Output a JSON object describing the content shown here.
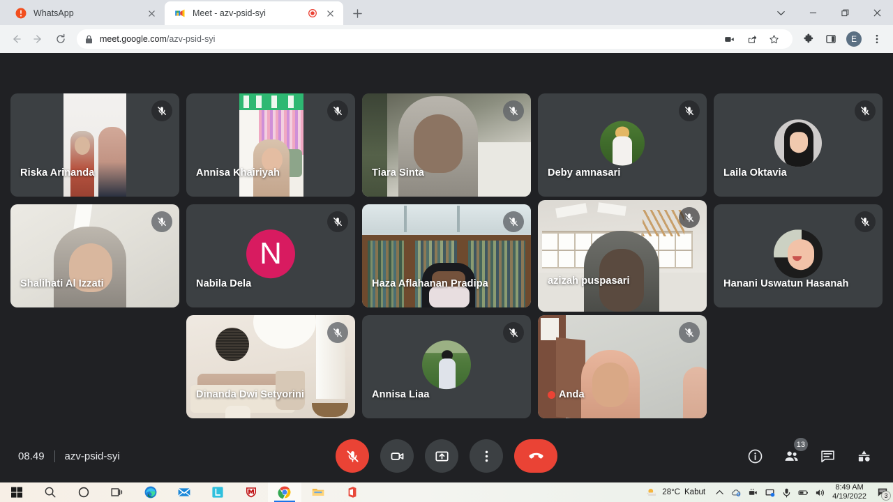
{
  "browser": {
    "tabs": [
      {
        "title": "WhatsApp",
        "favicon": "whatsapp-icon",
        "active": false,
        "recording": false
      },
      {
        "title": "Meet - azv-psid-syi",
        "favicon": "google-meet-icon",
        "active": true,
        "recording": true
      }
    ],
    "new_tab_label": "+",
    "window_controls": [
      "chevron-down",
      "minimize",
      "restore",
      "close"
    ],
    "address": {
      "host": "meet.google.com",
      "path": "/azv-psid-syi",
      "secure": true
    },
    "toolbar_icons": [
      "video-call-icon",
      "share-icon",
      "bookmark-star-icon",
      "extensions-icon",
      "side-panel-icon"
    ],
    "profile_initial": "E"
  },
  "meet": {
    "participants": [
      {
        "name": "Riska Arinanda",
        "muted": true,
        "kind": "video",
        "mic_badge": "dark"
      },
      {
        "name": "Annisa Khairiyah",
        "muted": true,
        "kind": "video",
        "mic_badge": "dark"
      },
      {
        "name": "Tiara Sinta",
        "muted": true,
        "kind": "video",
        "mic_badge": "light"
      },
      {
        "name": "Deby amnasari",
        "muted": true,
        "kind": "avatar",
        "mic_badge": "dark"
      },
      {
        "name": "Laila Oktavia",
        "muted": true,
        "kind": "avatar",
        "mic_badge": "dark"
      },
      {
        "name": "Shalihati Al Izzati",
        "muted": true,
        "kind": "video",
        "mic_badge": "light"
      },
      {
        "name": "Nabila Dela",
        "muted": true,
        "kind": "letter",
        "letter": "N",
        "letter_color": "#d81b60",
        "mic_badge": "dark"
      },
      {
        "name": "Haza Aflahanan Pradipa",
        "muted": true,
        "kind": "video",
        "mic_badge": "light"
      },
      {
        "name": "azizah puspasari",
        "muted": true,
        "kind": "video",
        "mic_badge": "dark"
      },
      {
        "name": "Hanani Uswatun Hasanah",
        "muted": true,
        "kind": "avatar",
        "mic_badge": "dark"
      },
      {
        "name": "Dinanda Dwi Setyorini",
        "muted": true,
        "kind": "video",
        "mic_badge": "light"
      },
      {
        "name": "Annisa Liaa",
        "muted": true,
        "kind": "avatar",
        "mic_badge": "dark"
      },
      {
        "name": "Anda",
        "muted": true,
        "kind": "video",
        "mic_badge": "light",
        "self": true
      }
    ],
    "bottom_bar": {
      "time": "08.49",
      "meeting_code": "azv-psid-syi",
      "controls": [
        {
          "name": "microphone-off-button",
          "state": "muted"
        },
        {
          "name": "camera-button",
          "state": "on"
        },
        {
          "name": "present-screen-button",
          "state": "off"
        },
        {
          "name": "more-options-button",
          "state": "off"
        },
        {
          "name": "leave-call-button",
          "state": "danger"
        }
      ],
      "right_controls": [
        {
          "name": "meeting-details-button"
        },
        {
          "name": "show-everyone-button",
          "badge": "13"
        },
        {
          "name": "chat-button"
        },
        {
          "name": "activities-button"
        }
      ]
    }
  },
  "taskbar": {
    "items": [
      "start-button",
      "search-icon",
      "cortana-icon",
      "task-view-icon",
      "microsoft-edge-icon",
      "mail-icon",
      "line-icon",
      "mcafee-icon",
      "google-chrome-icon",
      "file-explorer-icon",
      "office-icon"
    ],
    "tray": {
      "weather_temp": "28°C",
      "weather_desc": "Kabut",
      "icons": [
        "show-hidden-icons-chevron",
        "onedrive-icon",
        "camera-privacy-icon",
        "screen-share-icon",
        "microphone-icon",
        "battery-icon",
        "volume-icon"
      ],
      "time": "8:49 AM",
      "date": "4/19/2022",
      "notification_count": "3"
    }
  },
  "colors": {
    "meet_bg": "#202124",
    "tile_bg": "#3c4043",
    "danger": "#ea4335",
    "chrome_tabstrip": "#dee1e6",
    "chrome_toolbar": "#f1f3f4",
    "accent_blue": "#1a73e8"
  }
}
